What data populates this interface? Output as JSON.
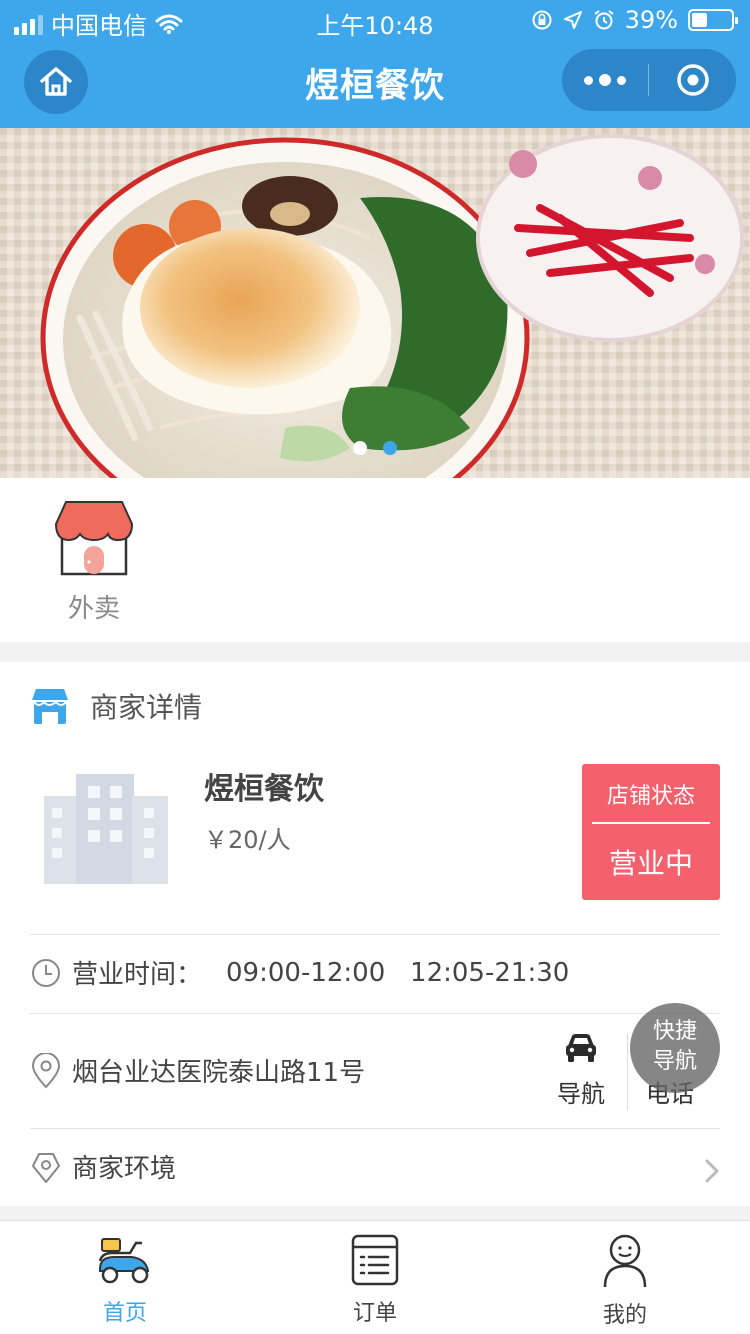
{
  "status_bar": {
    "carrier": "中国电信",
    "time": "上午10:48",
    "battery": "39%",
    "battery_level": 0.39
  },
  "nav": {
    "title": "煜桓餐饮",
    "home_icon": "home-icon",
    "more_icon": "more-icon",
    "close_icon": "target-icon",
    "bar_color": "#3ea6ea"
  },
  "banner": {
    "slide_count": 2,
    "active_index": 1,
    "dot_active_color": "#3ea6ea",
    "dot_inactive_color": "#ffffff"
  },
  "categories": [
    {
      "label": "外卖",
      "icon": "storefront-icon"
    }
  ],
  "merchant": {
    "section_title": "商家详情",
    "name": "煜桓餐饮",
    "price": "￥20/人",
    "status_label": "店铺状态",
    "status_value": "营业中",
    "status_color": "#f4616c",
    "hours_label": "营业时间：",
    "hours_value": "09:00-12:00   12:05-21:30",
    "address": "烟台业达医院泰山路11号",
    "navigate_label": "导航",
    "phone_label": "电话",
    "environment_label": "商家环境"
  },
  "fab": {
    "line1": "快捷",
    "line2": "导航"
  },
  "tabbar": {
    "active_color": "#3ea6ea",
    "items": [
      {
        "label": "首页",
        "icon": "scooter-icon",
        "active": true
      },
      {
        "label": "订单",
        "icon": "order-list-icon",
        "active": false
      },
      {
        "label": "我的",
        "icon": "profile-icon",
        "active": false
      }
    ]
  }
}
